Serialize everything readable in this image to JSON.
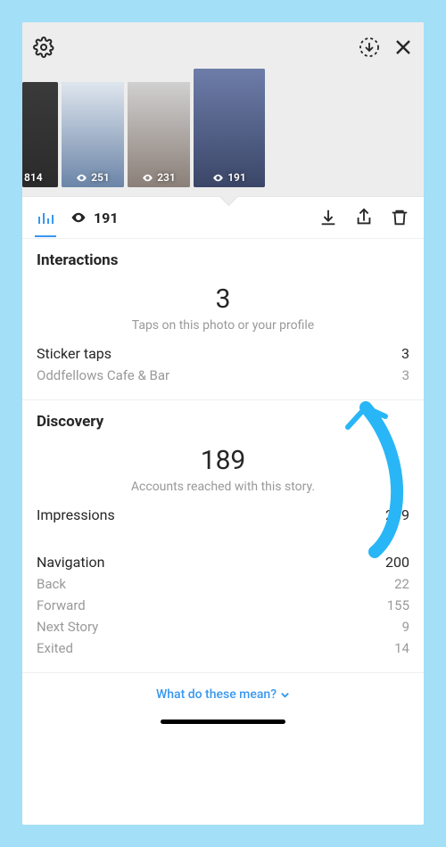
{
  "header": {
    "settings_icon": "gear-icon",
    "save_icon": "save-circle-icon",
    "close_icon": "close-icon"
  },
  "stories": [
    {
      "views": "814",
      "partial": true
    },
    {
      "views": "251"
    },
    {
      "views": "231"
    },
    {
      "views": "191",
      "selected": true
    }
  ],
  "tabs": {
    "view_count": "191"
  },
  "interactions": {
    "title": "Interactions",
    "big_number": "3",
    "big_caption": "Taps on this photo or your profile",
    "sticker_taps_label": "Sticker taps",
    "sticker_taps_value": "3",
    "sticker_sub_label": "Oddfellows Cafe & Bar",
    "sticker_sub_value": "3"
  },
  "discovery": {
    "title": "Discovery",
    "big_number": "189",
    "big_caption": "Accounts reached with this story.",
    "impressions_label": "Impressions",
    "impressions_value": "239",
    "navigation_label": "Navigation",
    "navigation_value": "200",
    "back_label": "Back",
    "back_value": "22",
    "forward_label": "Forward",
    "forward_value": "155",
    "next_label": "Next Story",
    "next_value": "9",
    "exited_label": "Exited",
    "exited_value": "14"
  },
  "footer": {
    "link_text": "What do these mean?"
  }
}
